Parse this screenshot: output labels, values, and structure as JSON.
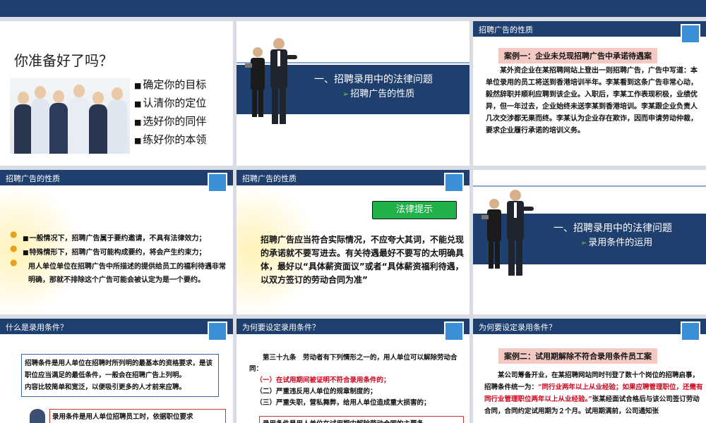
{
  "colors": {
    "navy": "#1f3f6e",
    "accent_blue": "#3a8fd6",
    "case_pink": "#f4c9c3",
    "legal_green": "#21b14a",
    "warn_red": "#d0021b"
  },
  "slide1": {
    "title": "你准备好了吗？",
    "items": [
      "确定你的目标",
      "认清你的定位",
      "选好你的同伴",
      "练好你的本领"
    ]
  },
  "slide2": {
    "line1": "一、招聘录用中的法律问题",
    "line2": "招聘广告的性质"
  },
  "slide3": {
    "header": "招聘广告的性质",
    "case_title": "案例一：企业未兑现招聘广告中承诺待遇案",
    "body": "某外资企业在某招聘网站上登出一则招聘广告，广告中写道：本单位录用的员工将送到香港培训半年。李某看到这条广告非常心动，毅然辞职并顺利应聘到该企业。入职后，李某工作表现积极，业绩优异，但一年过去，企业始终未送李某到香港培训。李某跟企业负责人几次交涉都无果而终。李某认为企业存在欺诈，因而申请劳动仲裁，要求企业履行承诺的培训义务。"
  },
  "slide4": {
    "header": "招聘广告的性质",
    "p1": "一般情况下，招聘广告属于要约邀请，不具有法律效力；",
    "p2": "特殊情形下，招聘广告可能构成要约，将会产生约束力；",
    "p3": "用人单位单位在招聘广告中所描述的提供给员工的福利待遇非常明确，那就不排除这个广告可能会被认定为是一个要约。"
  },
  "slide5": {
    "header": "招聘广告的性质",
    "button": "法律提示",
    "body": "招聘广告应当符合实际情况，不应夸大其词，不能兑现的承诺就不要写进去。有关待遇最好不要写的太明确具体，最好以“具体薪资面议”或者“具体薪资福利待遇，以双方签订的劳动合同为准”"
  },
  "slide6": {
    "line1": "一、招聘录用中的法律问题",
    "line2": "录用条件的运用"
  },
  "slide7": {
    "header": "什么是录用条件？",
    "p1": "招聘条件是用人单位在招聘时所列明的最基本的资格要求，是该职位应当满足的最低条件，一般会在招聘广告上列明。",
    "p2": "内容比较简单和宽泛，以便吸引更多的人才前来应聘。",
    "p3": "录用条件是用人单位招聘员工时，依据职位要求"
  },
  "slide8": {
    "header": "为何要设定录用条件？",
    "intro": "第三十九条　劳动者有下列情形之一的，用人单位可以解除劳动合同：",
    "item1": "（一）在试用期间被证明不符合录用条件的；",
    "item2": "（二）严重违反用人单位的规章制度的；",
    "item3": "（三）严重失职，营私舞弊，给用人单位造成重大损害的；",
    "box": "录用条件是用人单位在试用期内解除劳动合同的主要条"
  },
  "slide9": {
    "header": "为何要设定录用条件？",
    "case_title": "案例二：试用期解除不符合录用条件员工案",
    "body_a": "某公司筹备开业，在某招聘网站同时刊登了数十个岗位的招聘启事，招聘条件统一为：",
    "body_red": "“同行业两年以上从业经验；如果应聘管理职位，还需有同行业管理职位两年以上从业经验。”",
    "body_b": "张某经面试合格后与该公司签订劳动合同，合同约定试用期为２个月。试用期满前，公司通知张"
  }
}
